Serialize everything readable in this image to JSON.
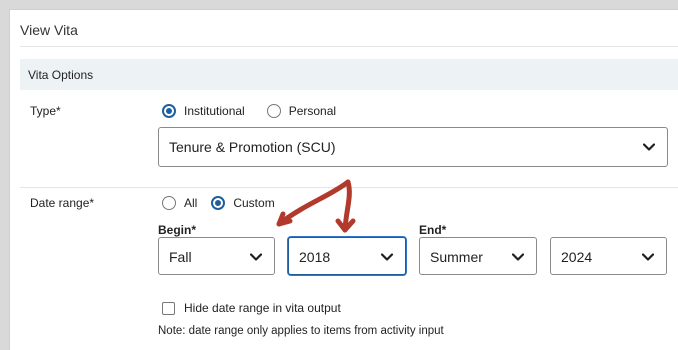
{
  "header": {
    "title": "View Vita"
  },
  "section": {
    "title": "Vita Options"
  },
  "type": {
    "label": "Type*",
    "options": [
      {
        "label": "Institutional",
        "checked": true
      },
      {
        "label": "Personal",
        "checked": false
      }
    ],
    "select_value": "Tenure & Promotion (SCU)"
  },
  "date_range": {
    "label": "Date range*",
    "options": [
      {
        "label": "All",
        "checked": false
      },
      {
        "label": "Custom",
        "checked": true
      }
    ],
    "begin_label": "Begin*",
    "end_label": "End*",
    "begin_term": "Fall",
    "begin_year": "2018",
    "end_term": "Summer",
    "end_year": "2024",
    "hide_checkbox_label": "Hide date range in vita output",
    "hide_checked": false,
    "note": "Note: date range only applies to items from activity input"
  },
  "annotation": {
    "color": "#b23a2c",
    "icon": "hand-drawn-arrows"
  },
  "colors": {
    "accent": "#1f5e9e",
    "section_bg": "#edf3f5"
  }
}
